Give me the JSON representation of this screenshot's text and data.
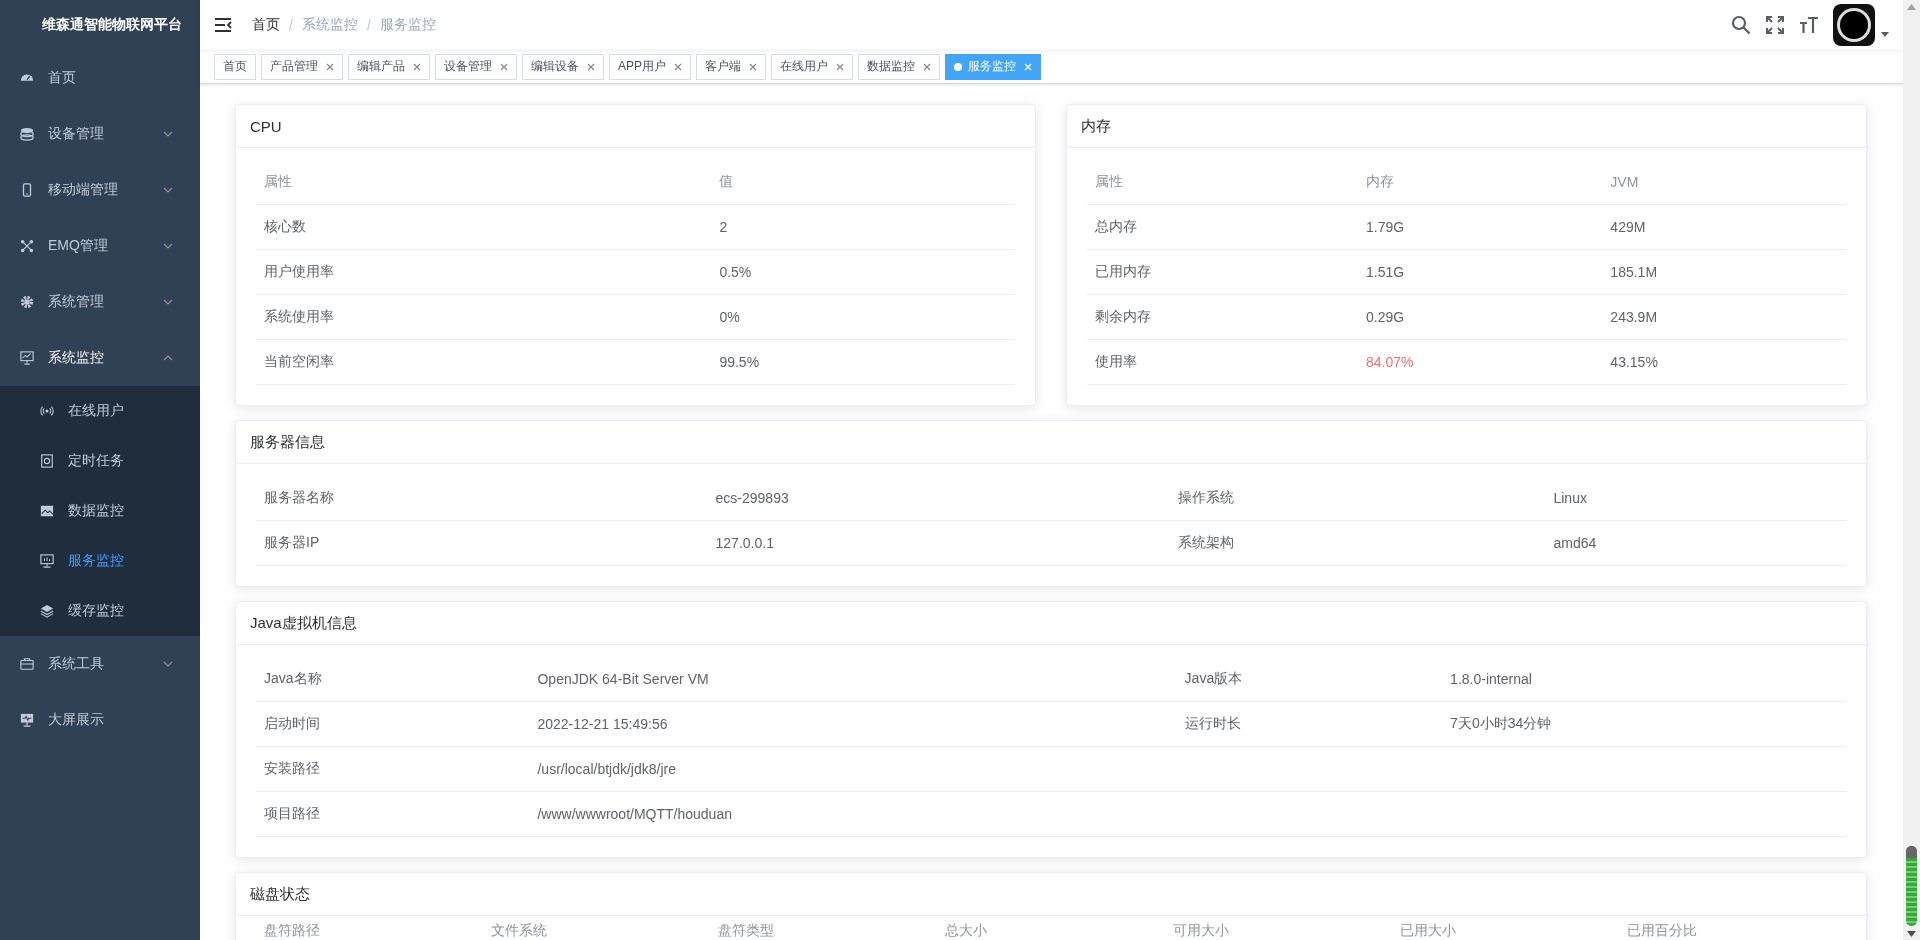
{
  "sidebar": {
    "title": "维森通智能物联网平台",
    "items": [
      {
        "label": "首页",
        "kind": "link"
      },
      {
        "label": "设备管理",
        "kind": "group",
        "expanded": false
      },
      {
        "label": "移动端管理",
        "kind": "group",
        "expanded": false
      },
      {
        "label": "EMQ管理",
        "kind": "group",
        "expanded": false
      },
      {
        "label": "系统管理",
        "kind": "group",
        "expanded": false
      },
      {
        "label": "系统监控",
        "kind": "group",
        "expanded": true,
        "children": [
          {
            "label": "在线用户",
            "selected": false
          },
          {
            "label": "定时任务",
            "selected": false
          },
          {
            "label": "数据监控",
            "selected": false
          },
          {
            "label": "服务监控",
            "selected": true
          },
          {
            "label": "缓存监控",
            "selected": false
          }
        ]
      },
      {
        "label": "系统工具",
        "kind": "group",
        "expanded": false
      },
      {
        "label": "大屏展示",
        "kind": "link"
      }
    ]
  },
  "breadcrumb": {
    "separator": "/",
    "items": [
      "首页",
      "系统监控",
      "服务监控"
    ]
  },
  "tabs": [
    {
      "label": "首页",
      "selected": false,
      "closable": false
    },
    {
      "label": "产品管理",
      "selected": false,
      "closable": true
    },
    {
      "label": "编辑产品",
      "selected": false,
      "closable": true
    },
    {
      "label": "设备管理",
      "selected": false,
      "closable": true
    },
    {
      "label": "编辑设备",
      "selected": false,
      "closable": true
    },
    {
      "label": "APP用户",
      "selected": false,
      "closable": true
    },
    {
      "label": "客户端",
      "selected": false,
      "closable": true
    },
    {
      "label": "在线用户",
      "selected": false,
      "closable": true
    },
    {
      "label": "数据监控",
      "selected": false,
      "closable": true
    },
    {
      "label": "服务监控",
      "selected": true,
      "closable": true
    }
  ],
  "cpu": {
    "title": "CPU",
    "columns": [
      "属性",
      "值"
    ],
    "rows": [
      [
        "核心数",
        "2"
      ],
      [
        "用户使用率",
        "0.5%"
      ],
      [
        "系统使用率",
        "0%"
      ],
      [
        "当前空闲率",
        "99.5%"
      ]
    ]
  },
  "memory": {
    "title": "内存",
    "columns": [
      "属性",
      "内存",
      "JVM"
    ],
    "rows": [
      [
        {
          "text": "总内存",
          "warning": false
        },
        {
          "text": "1.79G",
          "warning": false
        },
        {
          "text": "429M",
          "warning": false
        }
      ],
      [
        {
          "text": "已用内存",
          "warning": false
        },
        {
          "text": "1.51G",
          "warning": false
        },
        {
          "text": "185.1M",
          "warning": false
        }
      ],
      [
        {
          "text": "剩余内存",
          "warning": false
        },
        {
          "text": "0.29G",
          "warning": false
        },
        {
          "text": "243.9M",
          "warning": false
        }
      ],
      [
        {
          "text": "使用率",
          "warning": false
        },
        {
          "text": "84.07%",
          "warning": true
        },
        {
          "text": "43.15%",
          "warning": false
        }
      ]
    ]
  },
  "server": {
    "title": "服务器信息",
    "rows": [
      [
        "服务器名称",
        "ecs-299893",
        "操作系统",
        "Linux"
      ],
      [
        "服务器IP",
        "127.0.0.1",
        "系统架构",
        "amd64"
      ]
    ]
  },
  "jvm": {
    "title": "Java虚拟机信息",
    "rows": [
      [
        "Java名称",
        "OpenJDK 64-Bit Server VM",
        "Java版本",
        "1.8.0-internal"
      ],
      [
        "启动时间",
        "2022-12-21 15:49:56",
        "运行时长",
        "7天0小时34分钟"
      ],
      [
        "安装路径",
        "/usr/local/btjdk/jdk8/jre"
      ],
      [
        "项目路径",
        "/www/wwwroot/MQTT/houduan"
      ]
    ]
  },
  "disk": {
    "title": "磁盘状态",
    "columns": [
      "盘符路径",
      "文件系统",
      "盘符类型",
      "总大小",
      "可用大小",
      "已用大小",
      "已用百分比"
    ]
  }
}
